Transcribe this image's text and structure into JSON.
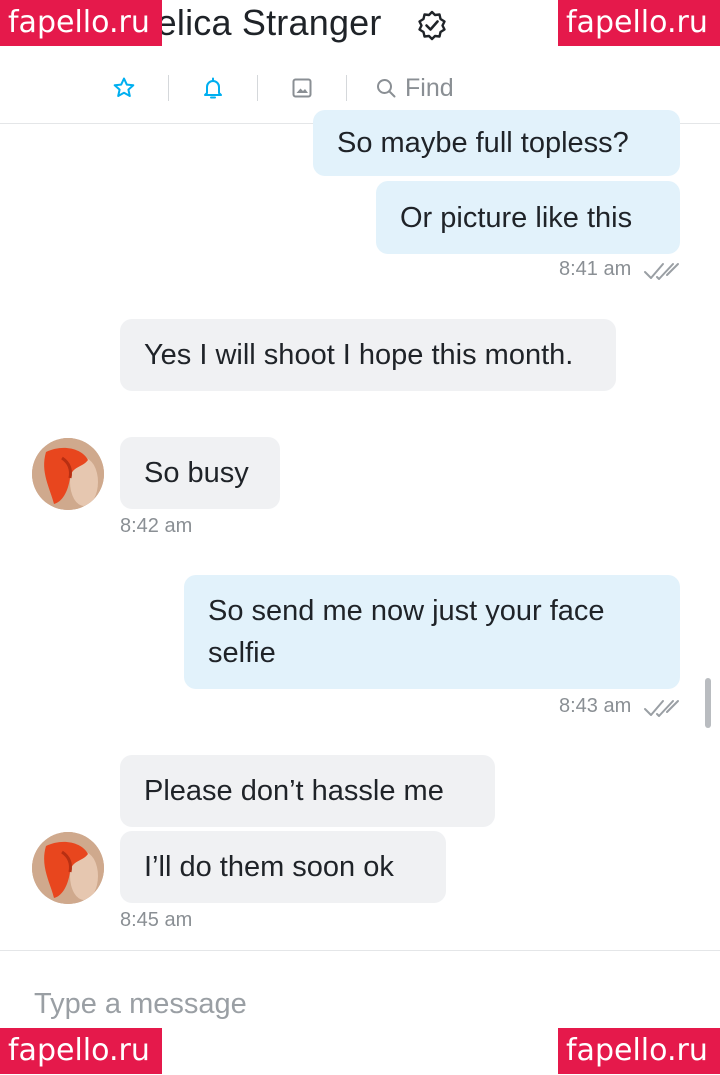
{
  "header": {
    "contact_name": "Angelica Stranger",
    "find_label": "Find"
  },
  "messages": [
    {
      "direction": "out",
      "text": "So maybe full topless?"
    },
    {
      "direction": "out",
      "text": "Or picture like this",
      "time": "8:41 am"
    },
    {
      "direction": "in",
      "text": "Yes I will shoot I hope this month."
    },
    {
      "direction": "in",
      "text": "So busy",
      "time": "8:42 am"
    },
    {
      "direction": "out",
      "text": "So send me now just your face selfie",
      "time": "8:43 am"
    },
    {
      "direction": "in",
      "text": "Please don’t hassle me"
    },
    {
      "direction": "in",
      "text": "I’ll do them soon ok",
      "time": "8:45 am"
    }
  ],
  "composer": {
    "placeholder": "Type a message"
  },
  "watermark": "fapello.ru",
  "colors": {
    "accent": "#00aff0",
    "outgoing_bubble": "#e2f2fb",
    "incoming_bubble": "#f0f1f3",
    "watermark_bg": "#e5194b"
  },
  "icons": {
    "back": "back-arrow-icon",
    "verified": "verified-badge-icon",
    "favorite": "star-icon",
    "notifications": "bell-icon",
    "media": "image-icon",
    "search": "search-icon",
    "read": "double-check-icon"
  }
}
